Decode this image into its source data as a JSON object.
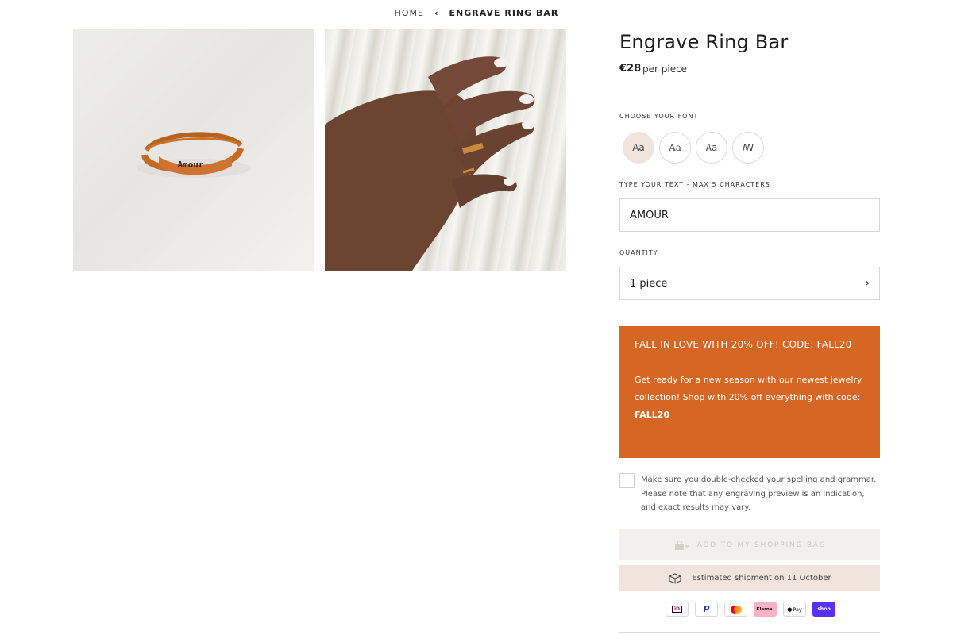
{
  "breadcrumb": {
    "home": "HOME",
    "separator": "‹",
    "current": "ENGRAVE RING BAR"
  },
  "product": {
    "title": "Engrave Ring Bar",
    "price": "€28",
    "price_unit": "per piece",
    "images": [
      {
        "engraving": "Amour"
      },
      {
        "engraving": ""
      }
    ]
  },
  "font_picker": {
    "label": "CHOOSE YOUR FONT",
    "options": [
      "Aa",
      "Aa",
      "Aa",
      "ꟿ"
    ],
    "selected_index": 0
  },
  "text_field": {
    "label": "TYPE YOUR TEXT - MAX 5 CHARACTERS",
    "value": "AMOUR"
  },
  "quantity": {
    "label": "QUANTITY",
    "value": "1 piece",
    "chevron": "›"
  },
  "promo": {
    "title": "FALL IN LOVE WITH 20% OFF! CODE: FALL20",
    "body": "Get ready for a new season with our newest jewelry collection! Shop with 20% off everything with code:",
    "code": "FALL20",
    "background": "#d56623"
  },
  "confirmation": {
    "text": "Make sure you double-checked your spelling and grammar. Please note that any engraving preview is an indication, and exact results may vary.",
    "checked": false
  },
  "add_to_bag": {
    "label": "ADD TO MY SHOPPING BAG",
    "icon": "bag-plus-icon",
    "disabled": true
  },
  "shipment": {
    "text": "Estimated shipment on 11 October",
    "icon": "box-icon"
  },
  "payments": [
    {
      "name": "ideal-icon",
      "label": "iD"
    },
    {
      "name": "paypal-icon",
      "label": "P"
    },
    {
      "name": "mastercard-icon",
      "label": ""
    },
    {
      "name": "klarna-icon",
      "label": "Klarna."
    },
    {
      "name": "applepay-icon",
      "label": "Pay"
    },
    {
      "name": "shoppay-icon",
      "label": "shop"
    }
  ],
  "colors": {
    "accent": "#d56623",
    "soft": "#f1e4dc",
    "text": "#1b1b1b"
  }
}
